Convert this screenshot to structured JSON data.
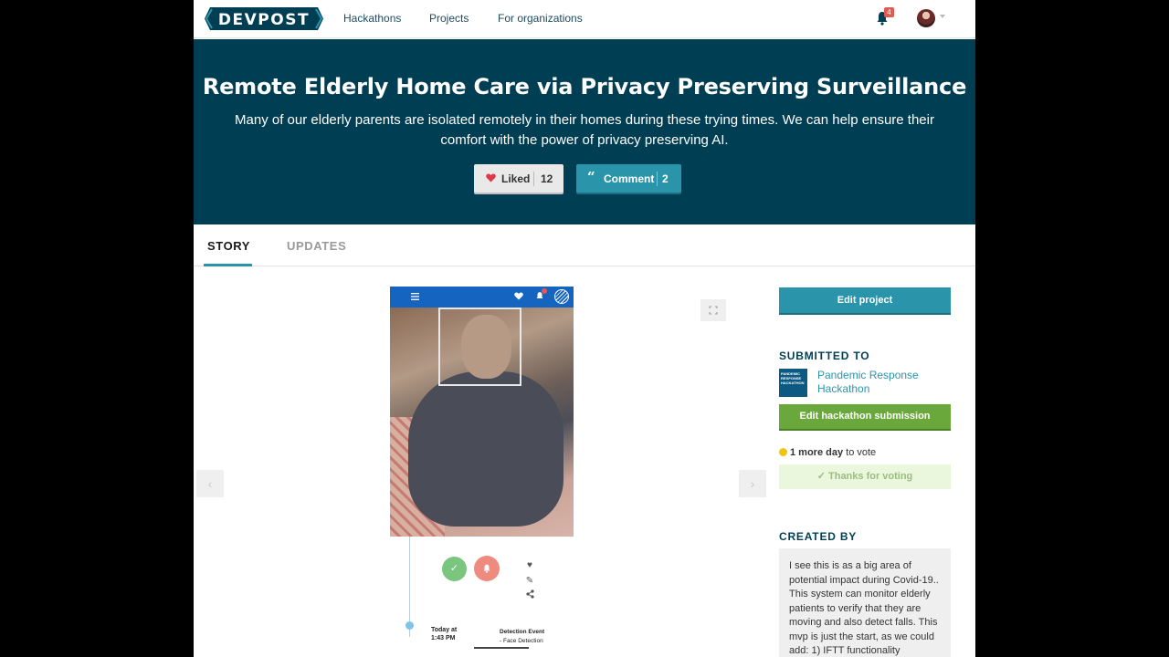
{
  "nav": {
    "logo": "DEVPOST",
    "links": [
      "Hackathons",
      "Projects",
      "For organizations"
    ],
    "notification_count": "4"
  },
  "hero": {
    "title": "Remote Elderly Home Care via Privacy Preserving Surveillance",
    "tagline": "Many of our elderly parents are isolated remotely in their homes during these trying times. We can help ensure their comfort with the power of privacy preserving AI.",
    "like_label": "Liked",
    "like_count": "12",
    "comment_label": "Comment",
    "comment_count": "2"
  },
  "tabs": [
    "STORY",
    "UPDATES"
  ],
  "gallery": {
    "timeline_date": "Today at\n1:43 PM",
    "timeline_event": "Detection Event",
    "timeline_detail": "- Face Detection"
  },
  "sidebar": {
    "edit_project": "Edit project",
    "submitted_to_heading": "SUBMITTED TO",
    "hackathon_name": "Pandemic Response Hackathon",
    "hackathon_thumb_text": "PANDEMIC RESPONSE HACKATHON",
    "edit_hackathon_submission": "Edit hackathon submission",
    "vote_time": "1 more day",
    "vote_suffix": " to vote",
    "thanks_voting": "Thanks for voting",
    "created_by_heading": "CREATED BY",
    "creator_note": "I see this is as a big area of potential impact during Covid-19.. This system can monitor elderly patients to verify that they are moving and also detect falls. This mvp is just the start, as we could add: 1) IFTT functionality"
  },
  "colors": {
    "brand_dark": "#003e54",
    "accent_teal": "#2a95aa",
    "green": "#6ba83c",
    "heart": "#e0394b"
  }
}
